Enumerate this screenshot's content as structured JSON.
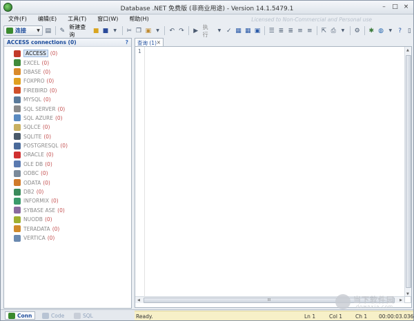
{
  "window": {
    "title": "Database .NET 免费版 (非商业用途) - Version 14.1.5479.1",
    "license_note": "Licensed to Non-Commercial and Personal use"
  },
  "menu": [
    "文件(F)",
    "编辑(E)",
    "工具(T)",
    "窗口(W)",
    "帮助(H)"
  ],
  "toolbar": {
    "connect_label": "连接",
    "new_query_label": "新建查询",
    "execute_label": "执行"
  },
  "left_panel": {
    "header": "ACCESS connections (0)",
    "help": "?",
    "connections": [
      {
        "name": "ACCESS",
        "count": "(0)",
        "color": "#c23a2a"
      },
      {
        "name": "EXCEL",
        "count": "(0)",
        "color": "#3f8a3a"
      },
      {
        "name": "DBASE",
        "count": "(0)",
        "color": "#d98a2a"
      },
      {
        "name": "FOXPRO",
        "count": "(0)",
        "color": "#e0a020"
      },
      {
        "name": "FIREBIRD",
        "count": "(0)",
        "color": "#d0502a"
      },
      {
        "name": "MYSQL",
        "count": "(0)",
        "color": "#5a7a9a"
      },
      {
        "name": "SQL SERVER",
        "count": "(0)",
        "color": "#8a8a8a"
      },
      {
        "name": "SQL AZURE",
        "count": "(0)",
        "color": "#5a8ac0"
      },
      {
        "name": "SQLCE",
        "count": "(0)",
        "color": "#c8b060"
      },
      {
        "name": "SQLITE",
        "count": "(0)",
        "color": "#4a5a6a"
      },
      {
        "name": "POSTGRESQL",
        "count": "(0)",
        "color": "#4a6a9a"
      },
      {
        "name": "ORACLE",
        "count": "(0)",
        "color": "#d03030"
      },
      {
        "name": "OLE DB",
        "count": "(0)",
        "color": "#5a7ab0"
      },
      {
        "name": "ODBC",
        "count": "(0)",
        "color": "#7a8a9a"
      },
      {
        "name": "ODATA",
        "count": "(0)",
        "color": "#d07a2a"
      },
      {
        "name": "DB2",
        "count": "(0)",
        "color": "#3a8a5a"
      },
      {
        "name": "INFORMIX",
        "count": "(0)",
        "color": "#3a9a6a"
      },
      {
        "name": "SYBASE ASE",
        "count": "(0)",
        "color": "#8a6aa0"
      },
      {
        "name": "NUODB",
        "count": "(0)",
        "color": "#a0b030"
      },
      {
        "name": "TERADATA",
        "count": "(0)",
        "color": "#d08a2a"
      },
      {
        "name": "VERTICA",
        "count": "(0)",
        "color": "#6a8ab0"
      }
    ]
  },
  "editor": {
    "tab_label": "查询 (1)",
    "tab_close": "×",
    "line_number": "1",
    "hscroll_grip": "III"
  },
  "bottom_tabs": [
    {
      "label": "Conn"
    },
    {
      "label": "Code"
    },
    {
      "label": "SQL"
    }
  ],
  "status": {
    "text": "Ready.",
    "ln": "Ln 1",
    "col": "Col 1",
    "ch": "Ch 1",
    "time": "00:00:03.036"
  },
  "watermark": {
    "title": "当下软件园",
    "url": "downxia.com"
  }
}
